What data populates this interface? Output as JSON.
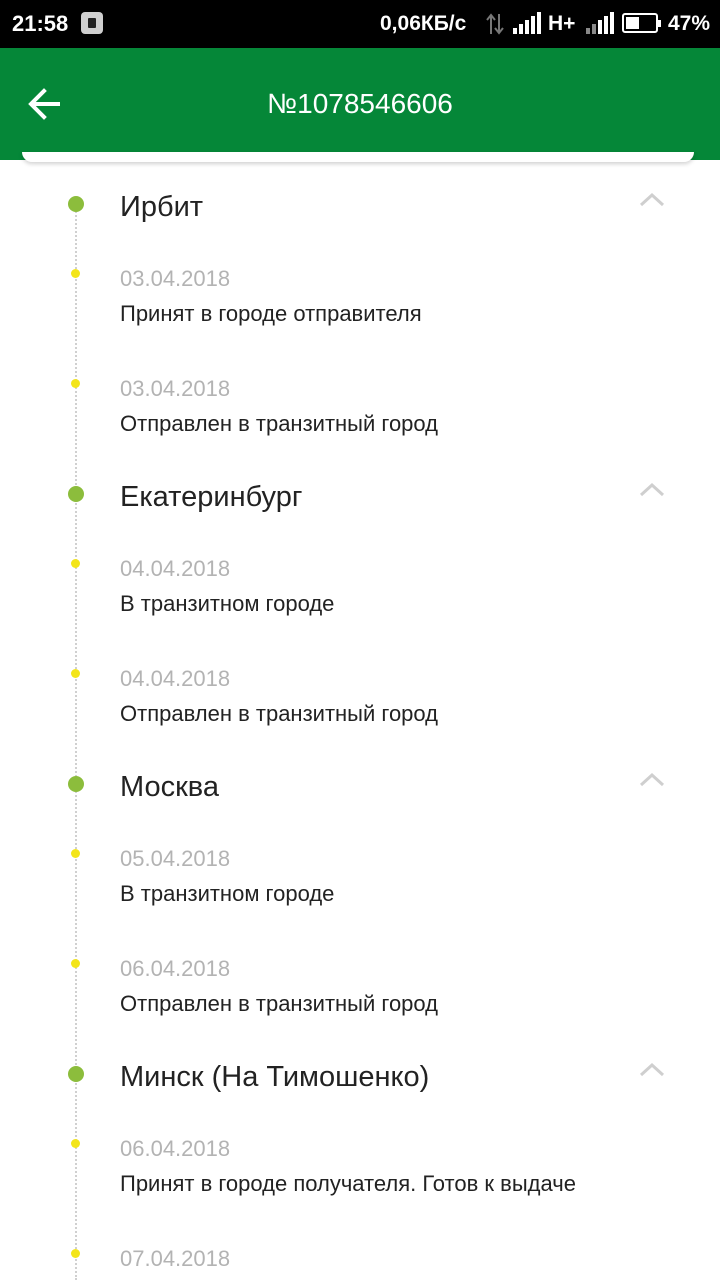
{
  "status_bar": {
    "time": "21:58",
    "speed": "0,06КБ/с",
    "network": "H+",
    "battery_percent": "47%",
    "battery_level": 0.47
  },
  "header": {
    "title": "№1078546606",
    "back_icon": "arrow-left-icon"
  },
  "colors": {
    "app_bar": "#058738",
    "city_dot": "#8cbd3c",
    "event_dot": "#f3e51a",
    "date_text": "#b3b3b3"
  },
  "timeline": [
    {
      "city": "Ирбит",
      "events": [
        {
          "date": "03.04.2018",
          "status": "Принят в городе отправителя"
        },
        {
          "date": "03.04.2018",
          "status": "Отправлен в транзитный город"
        }
      ]
    },
    {
      "city": "Екатеринбург",
      "events": [
        {
          "date": "04.04.2018",
          "status": "В транзитном городе"
        },
        {
          "date": "04.04.2018",
          "status": "Отправлен в транзитный город"
        }
      ]
    },
    {
      "city": "Москва",
      "events": [
        {
          "date": "05.04.2018",
          "status": "В транзитном городе"
        },
        {
          "date": "06.04.2018",
          "status": "Отправлен в транзитный город"
        }
      ]
    },
    {
      "city": "Минск (На Тимошенко)",
      "events": [
        {
          "date": "06.04.2018",
          "status": "Принят в городе получателя. Готов к выдаче"
        },
        {
          "date": "07.04.2018",
          "status": ""
        }
      ]
    }
  ]
}
